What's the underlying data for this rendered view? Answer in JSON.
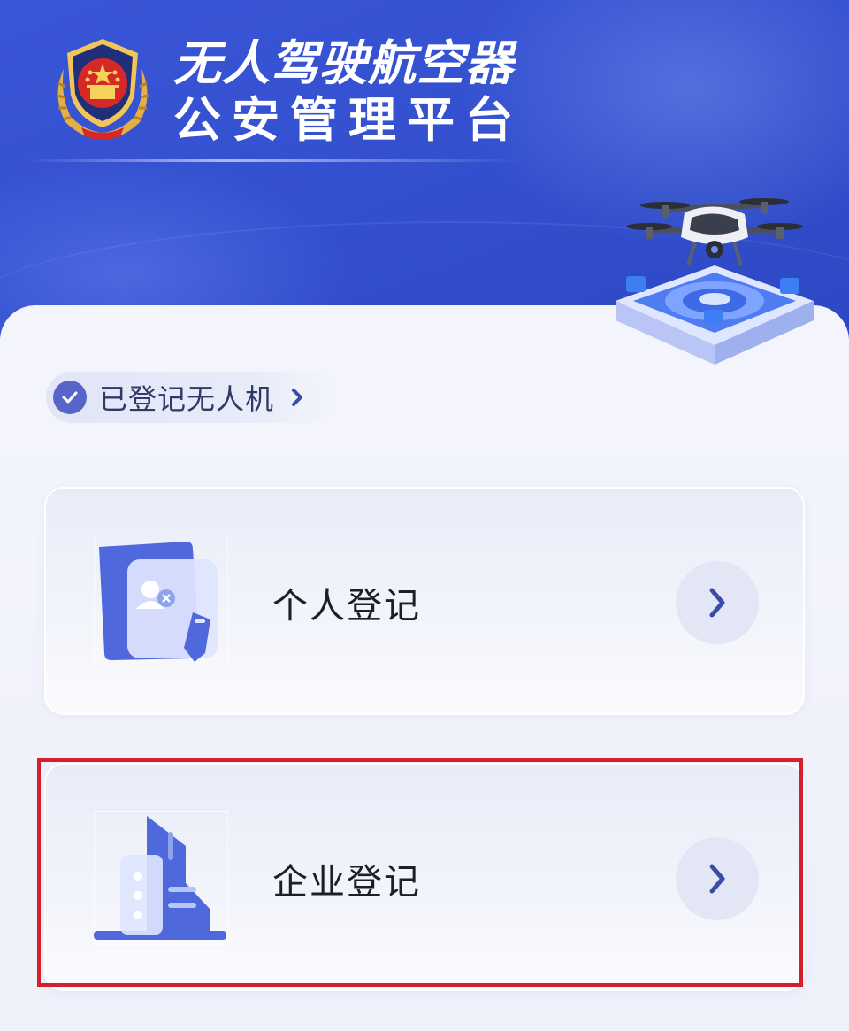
{
  "header": {
    "title_line1": "无人驾驶航空器",
    "title_line2": "公安管理平台"
  },
  "registered_chip": {
    "label": "已登记无人机"
  },
  "cards": [
    {
      "label": "个人登记"
    },
    {
      "label": "企业登记"
    }
  ],
  "colors": {
    "header_blue": "#3350cf",
    "accent_blue": "#5865c8",
    "highlight_red": "#d4202a"
  },
  "icons": {
    "emblem": "police-emblem-icon",
    "check": "check-circle-icon",
    "chevron": "chevron-right-icon",
    "personal": "id-card-icon",
    "enterprise": "building-icon",
    "drone": "drone-illustration"
  }
}
